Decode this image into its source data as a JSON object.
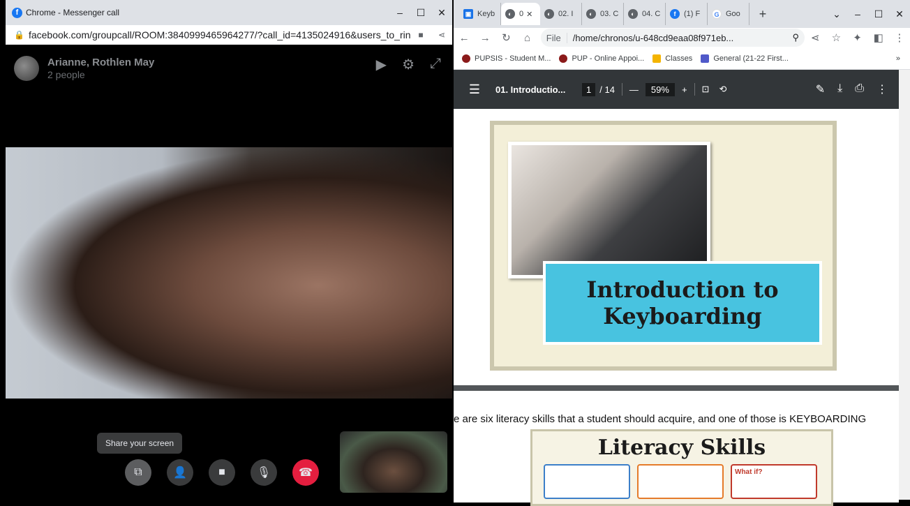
{
  "left_window": {
    "title": "Chrome - Messenger call",
    "url": "facebook.com/groupcall/ROOM:3840999465964277/?call_id=4135024916&users_to_ring[...",
    "call": {
      "participants": "Arianne, Rothlen May",
      "count": "2 people"
    },
    "tooltip": "Share your screen"
  },
  "right_window": {
    "tabs": [
      {
        "label": "Keyb",
        "color": "#1a73e8"
      },
      {
        "label": "0",
        "color": "#5f6368",
        "active": true
      },
      {
        "label": "02. I",
        "color": "#5f6368"
      },
      {
        "label": "03. C",
        "color": "#5f6368"
      },
      {
        "label": "04. C",
        "color": "#5f6368"
      },
      {
        "label": "(1) F",
        "color": "#1877f2"
      },
      {
        "label": "Goo",
        "color": "#4285f4"
      }
    ],
    "address": "/home/chronos/u-648cd9eaa08f971eb...",
    "file_label": "File",
    "bookmarks": [
      {
        "label": "PUPSIS - Student M...",
        "color": "#8b1a1a"
      },
      {
        "label": "PUP - Online Appoi...",
        "color": "#8b1a1a"
      },
      {
        "label": "Classes",
        "color": "#f4b400"
      },
      {
        "label": "General (21-22 First...",
        "color": "#5059c9"
      }
    ],
    "pdf": {
      "title": "01. Introductio...",
      "page": "1",
      "total": "/ 14",
      "zoom": "59%",
      "slide_title_1": "Introduction to",
      "slide_title_2": "Keyboarding",
      "body_text": "e are six literacy skills that a student should acquire, and one of those is KEYBOARDING",
      "slide2_title": "Literacy Skills",
      "card_label": "What if?"
    }
  }
}
